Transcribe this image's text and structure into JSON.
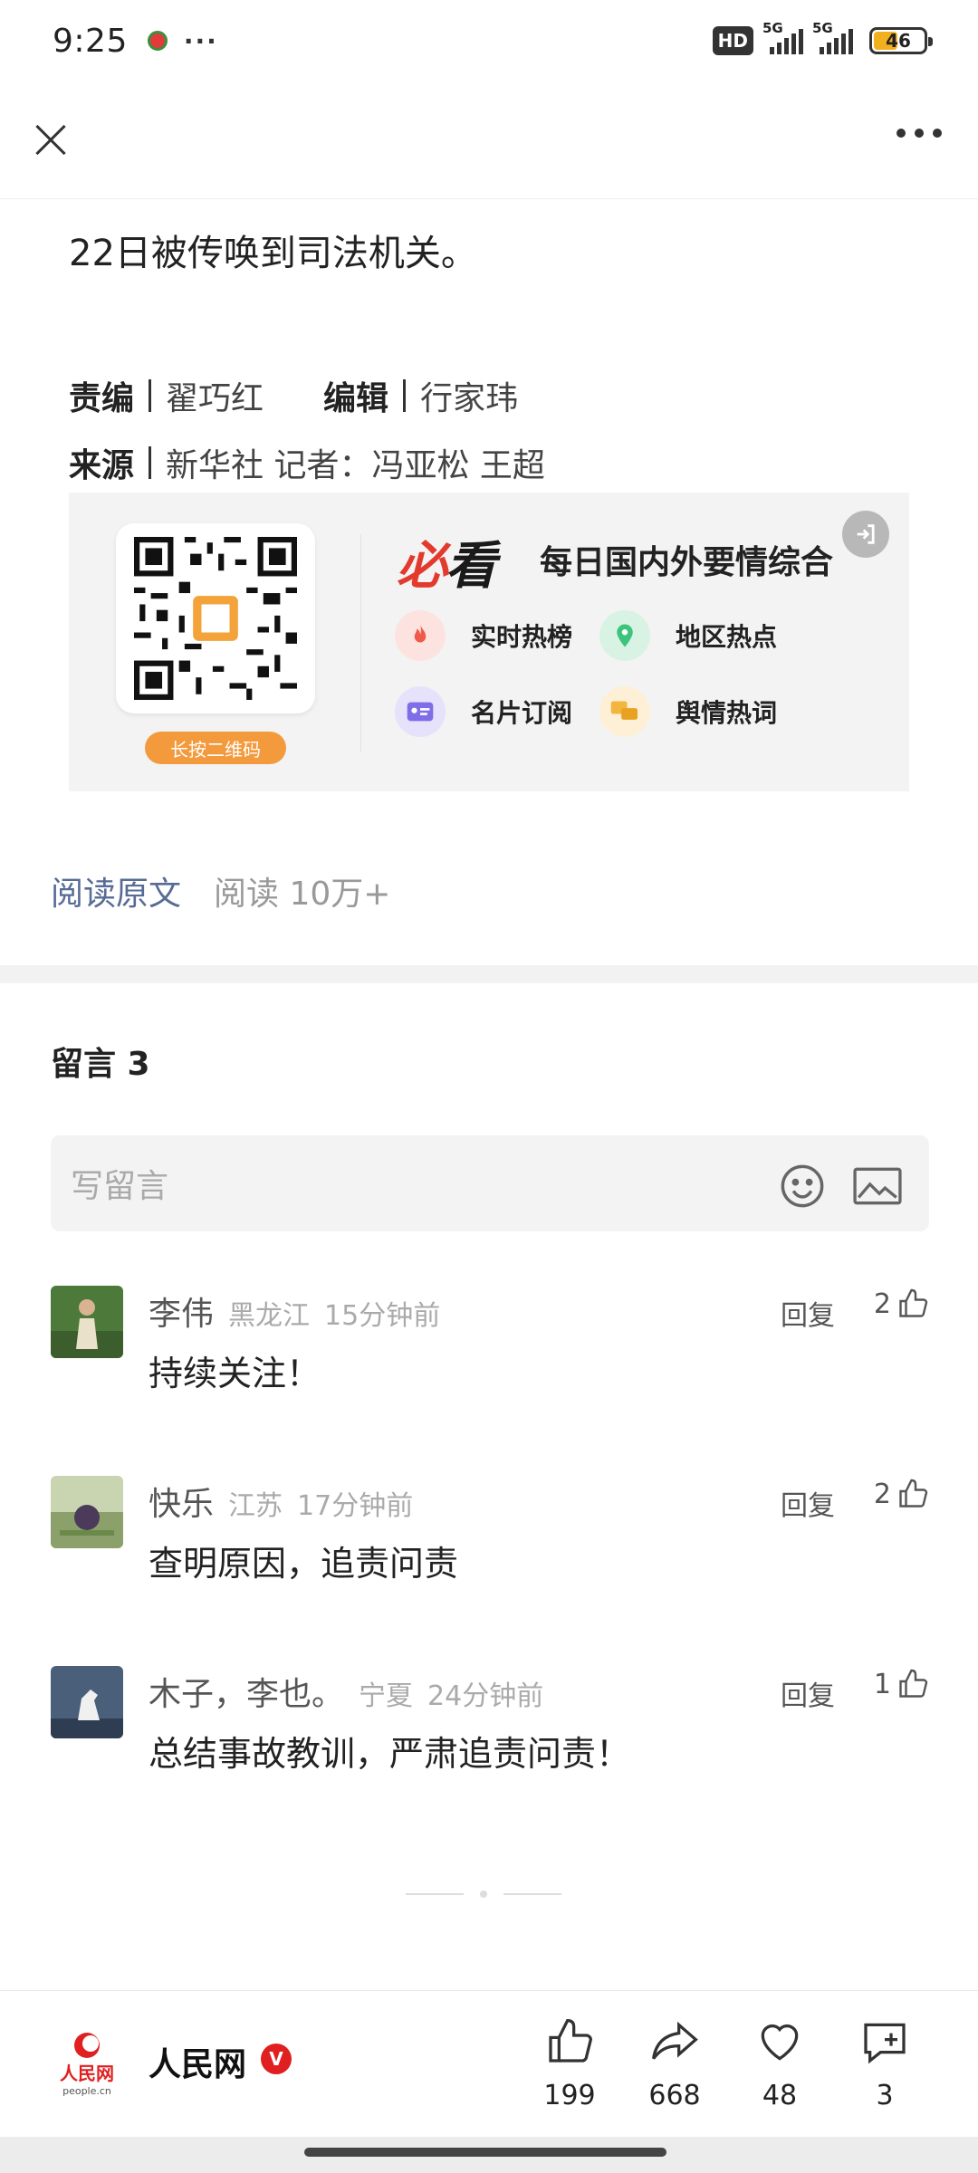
{
  "status_bar": {
    "time": "9:25",
    "more": "···",
    "hd": "HD",
    "net1": "5G",
    "net2": "5G",
    "battery": "46"
  },
  "article": {
    "last_line": "22日被传唤到司法机关。",
    "credits": {
      "editor_label": "责编",
      "editor_name": "翟巧红",
      "edit_label": "编辑",
      "edit_name": "行家玮",
      "source_label": "来源",
      "source_value": "新华社 记者：冯亚松 王超"
    }
  },
  "promo": {
    "qr_button": "长按二维码",
    "brand_red": "必",
    "brand_black": "看",
    "title": "每日国内外要情综合",
    "features": [
      {
        "label": "实时热榜",
        "icon": "fire-icon",
        "color": "#ef5a4a"
      },
      {
        "label": "地区热点",
        "icon": "location-pin-icon",
        "color": "#3cc47c"
      },
      {
        "label": "名片订阅",
        "icon": "id-card-icon",
        "color": "#7e6ee8"
      },
      {
        "label": "舆情热词",
        "icon": "chat-bubbles-icon",
        "color": "#f2b640"
      }
    ]
  },
  "read": {
    "link": "阅读原文",
    "count": "阅读 10万+"
  },
  "comments": {
    "title": "留言 3",
    "input_placeholder": "写留言",
    "reply_label": "回复",
    "items": [
      {
        "name": "李伟",
        "region": "黑龙江",
        "time": "15分钟前",
        "text": "持续关注！",
        "likes": "2"
      },
      {
        "name": "快乐",
        "region": "江苏",
        "time": "17分钟前",
        "text": "查明原因，追责问责",
        "likes": "2"
      },
      {
        "name": "木子，李也。",
        "region": "宁夏",
        "time": "24分钟前",
        "text": "总结事故教训，严肃追责问责！",
        "likes": "1"
      }
    ]
  },
  "bottom": {
    "account_name": "人民网",
    "verified": "V",
    "logo_text": "人民网",
    "logo_sub": "people.cn",
    "actions": [
      {
        "name": "like",
        "count": "199"
      },
      {
        "name": "share",
        "count": "668"
      },
      {
        "name": "favorite",
        "count": "48"
      },
      {
        "name": "comment",
        "count": "3"
      }
    ]
  },
  "colors": {
    "link": "#576b95",
    "accent_orange": "#f39a3d",
    "verified_red": "#e02020"
  }
}
